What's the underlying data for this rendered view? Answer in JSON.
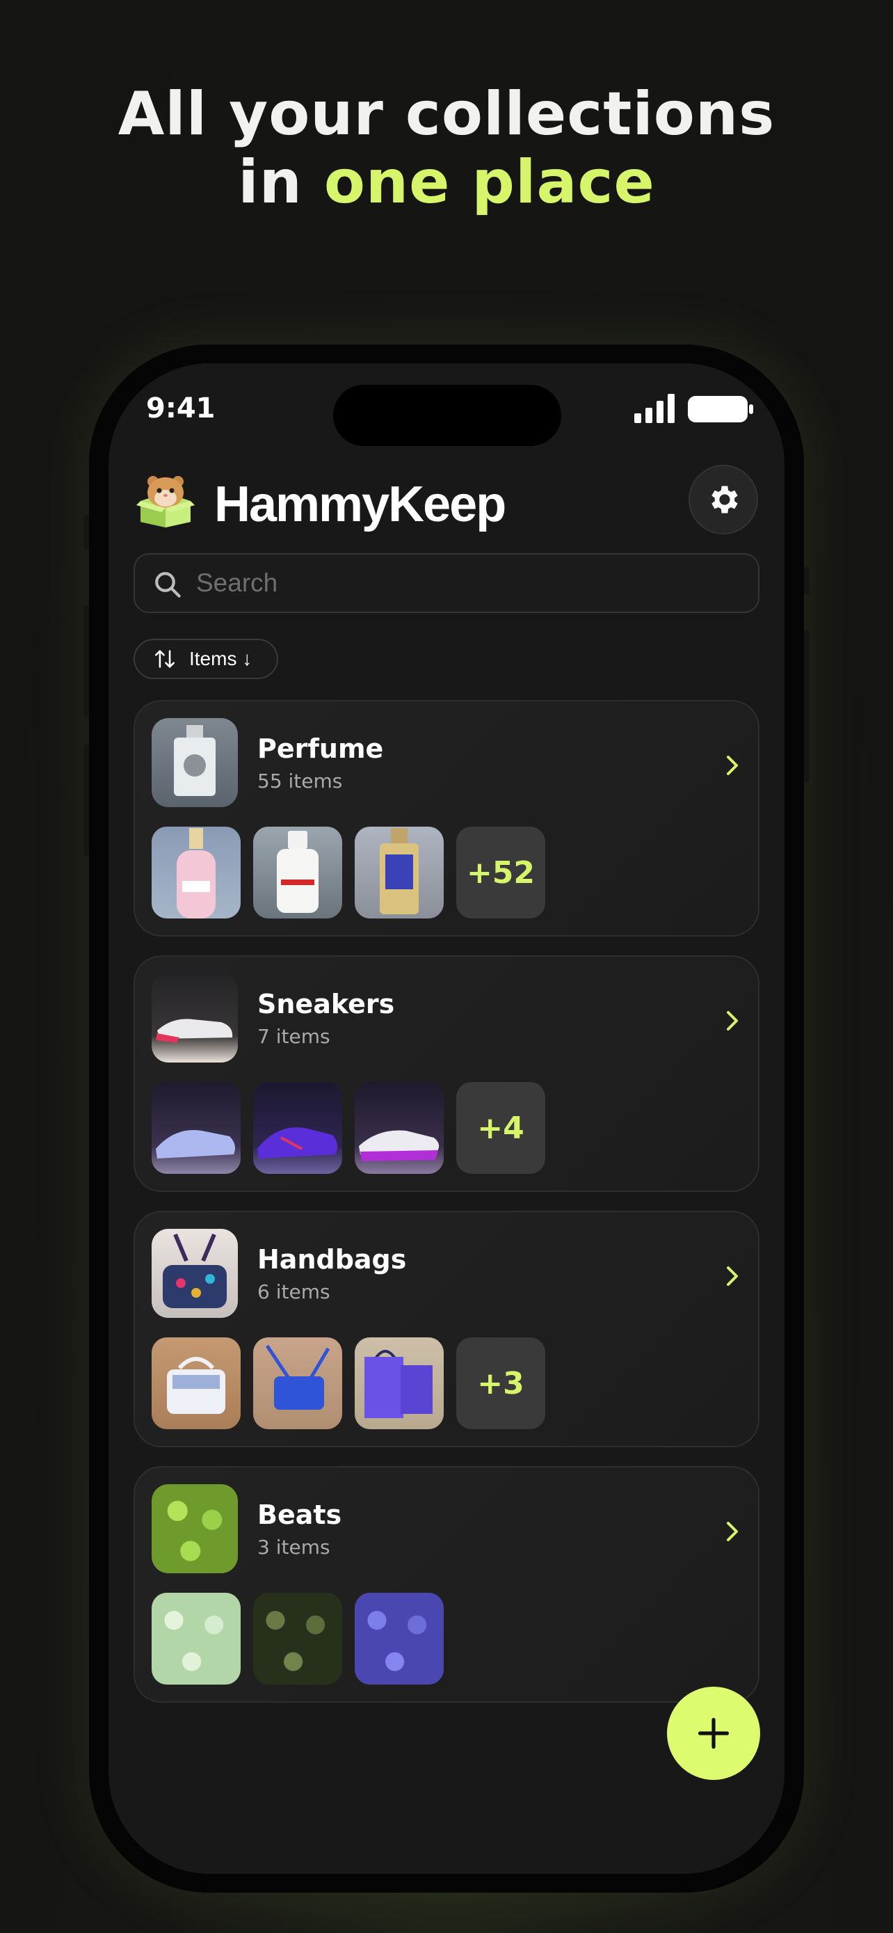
{
  "headline": {
    "line1": "All your collections",
    "line2_prefix": "in ",
    "line2_accent": "one place"
  },
  "status": {
    "time": "9:41"
  },
  "app": {
    "title": "HammyKeep",
    "search_placeholder": "Search",
    "sort_label": "Items ↓"
  },
  "collections": [
    {
      "title": "Perfume",
      "count": "55 items",
      "more": "+52"
    },
    {
      "title": "Sneakers",
      "count": "7 items",
      "more": "+4"
    },
    {
      "title": "Handbags",
      "count": "6 items",
      "more": "+3"
    },
    {
      "title": "Beats",
      "count": "3 items"
    }
  ],
  "icons": {
    "settings": "gear-icon",
    "search": "search-icon",
    "sort": "sort-arrows-icon",
    "chevron": "chevron-right-icon",
    "add": "plus-icon"
  },
  "colors": {
    "accent": "#d7f56a",
    "fab": "#dcfb6e",
    "background": "#181818"
  }
}
